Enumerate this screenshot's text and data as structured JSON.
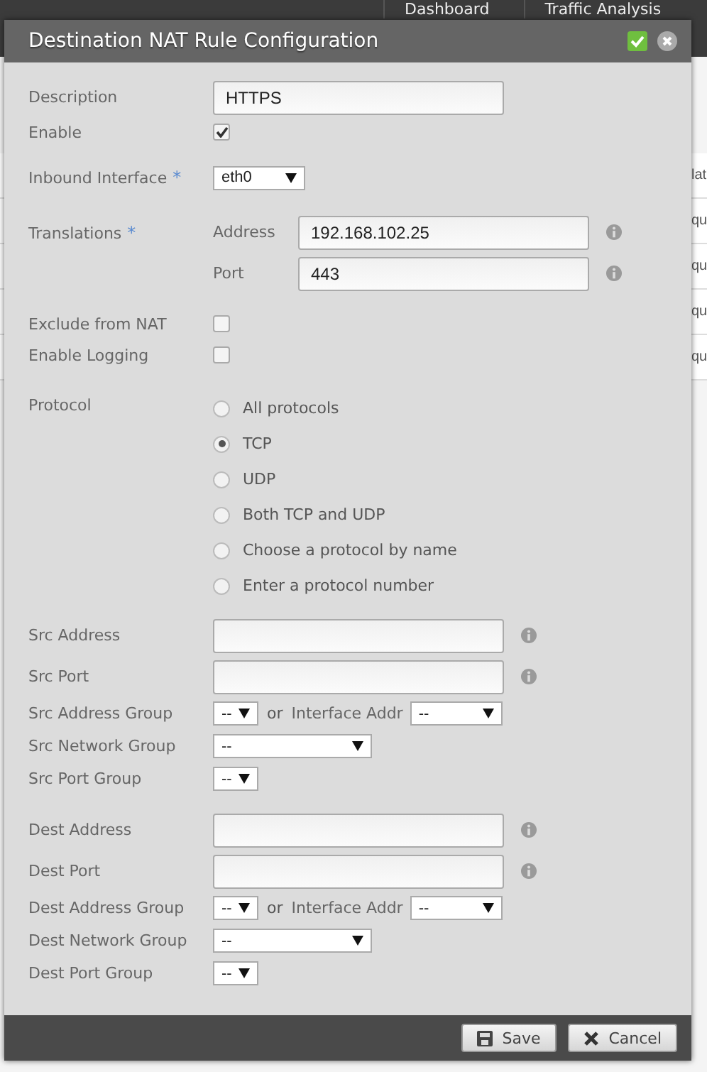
{
  "background": {
    "tabs": [
      "Dashboard",
      "Traffic Analysis"
    ],
    "fragments": [
      "lat",
      "qu",
      "qu",
      "qu",
      "qu"
    ]
  },
  "dialog": {
    "title": "Destination NAT Rule Configuration",
    "description": {
      "label": "Description",
      "value": "HTTPS"
    },
    "enable": {
      "label": "Enable",
      "checked": true
    },
    "inbound_interface": {
      "label": "Inbound Interface",
      "marker": "*",
      "value": "eth0"
    },
    "translations": {
      "label": "Translations",
      "marker": "*",
      "address": {
        "label": "Address",
        "value": "192.168.102.25"
      },
      "port": {
        "label": "Port",
        "value": "443"
      }
    },
    "exclude_from_nat": {
      "label": "Exclude from NAT",
      "checked": false
    },
    "enable_logging": {
      "label": "Enable Logging",
      "checked": false
    },
    "protocol": {
      "label": "Protocol",
      "options": [
        {
          "label": "All protocols",
          "selected": false
        },
        {
          "label": "TCP",
          "selected": true
        },
        {
          "label": "UDP",
          "selected": false
        },
        {
          "label": "Both TCP and UDP",
          "selected": false
        },
        {
          "label": "Choose a protocol by name",
          "selected": false
        },
        {
          "label": "Enter a protocol number",
          "selected": false
        }
      ]
    },
    "sections": [
      [
        {
          "kind": "input",
          "label": "Src Address"
        },
        {
          "kind": "input",
          "label": "Src Port"
        },
        {
          "kind": "group",
          "label": "Src Address Group",
          "value": "--",
          "connector": "or",
          "alt_label": "Interface Addr",
          "alt_value": "--"
        },
        {
          "kind": "wide",
          "label": "Src Network Group",
          "value": "--"
        },
        {
          "kind": "small",
          "label": "Src Port Group",
          "value": "--"
        }
      ],
      [
        {
          "kind": "input",
          "label": "Dest Address"
        },
        {
          "kind": "input",
          "label": "Dest Port"
        },
        {
          "kind": "group",
          "label": "Dest Address Group",
          "value": "--",
          "connector": "or",
          "alt_label": "Interface Addr",
          "alt_value": "--"
        },
        {
          "kind": "wide",
          "label": "Dest Network Group",
          "value": "--"
        },
        {
          "kind": "small",
          "label": "Dest Port Group",
          "value": "--"
        }
      ]
    ],
    "buttons": [
      {
        "kind": "save",
        "label": "Save"
      },
      {
        "kind": "cancel",
        "label": "Cancel"
      }
    ]
  }
}
